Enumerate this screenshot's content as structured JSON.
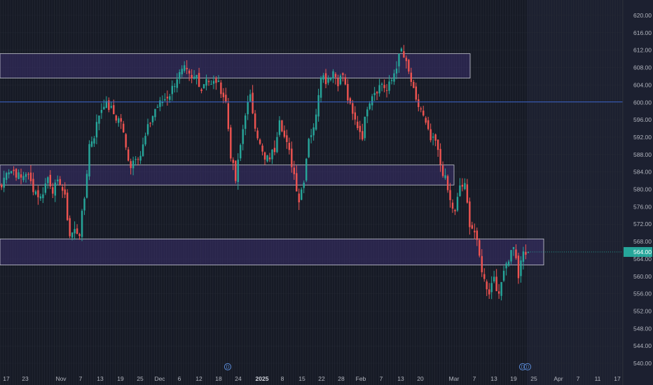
{
  "chart_data": {
    "type": "candlestick",
    "title": "",
    "ylim": [
      538,
      622
    ],
    "y_ticks": [
      "540.00",
      "544.00",
      "548.00",
      "552.00",
      "556.00",
      "560.00",
      "564.00",
      "568.00",
      "572.00",
      "576.00",
      "580.00",
      "584.00",
      "588.00",
      "592.00",
      "596.00",
      "600.00",
      "604.00",
      "608.00",
      "612.00",
      "616.00",
      "620.00"
    ],
    "x_ticks": [
      {
        "label": "17",
        "bold": false
      },
      {
        "label": "23",
        "bold": false
      },
      {
        "label": "Nov",
        "bold": false
      },
      {
        "label": "7",
        "bold": false
      },
      {
        "label": "13",
        "bold": false
      },
      {
        "label": "19",
        "bold": false
      },
      {
        "label": "25",
        "bold": false
      },
      {
        "label": "Dec",
        "bold": false
      },
      {
        "label": "6",
        "bold": false
      },
      {
        "label": "12",
        "bold": false
      },
      {
        "label": "18",
        "bold": false
      },
      {
        "label": "24",
        "bold": false
      },
      {
        "label": "2025",
        "bold": true
      },
      {
        "label": "8",
        "bold": false
      },
      {
        "label": "15",
        "bold": false
      },
      {
        "label": "22",
        "bold": false
      },
      {
        "label": "28",
        "bold": false
      },
      {
        "label": "Feb",
        "bold": false
      },
      {
        "label": "7",
        "bold": false
      },
      {
        "label": "13",
        "bold": false
      },
      {
        "label": "20",
        "bold": false
      },
      {
        "label": "Mar",
        "bold": false
      },
      {
        "label": "7",
        "bold": false
      },
      {
        "label": "13",
        "bold": false
      },
      {
        "label": "19",
        "bold": false
      },
      {
        "label": "25",
        "bold": false
      },
      {
        "label": "Apr",
        "bold": false
      },
      {
        "label": "7",
        "bold": false
      },
      {
        "label": "11",
        "bold": false
      },
      {
        "label": "17",
        "bold": false
      }
    ],
    "zones": [
      {
        "y_top": 611.2,
        "y_bottom": 605.6,
        "extends_to": "Feb 28"
      },
      {
        "y_top": 585.6,
        "y_bottom": 581.0,
        "extends_to": "Mar 24"
      },
      {
        "y_top": 568.6,
        "y_bottom": 562.6,
        "extends_to": "Mar 30"
      }
    ],
    "horizontal_line": 600.1,
    "current_price": 565.6,
    "current_price_label": "564.00",
    "event_markers": [
      "D",
      "D",
      "D"
    ],
    "colors": {
      "up": "#26a69a",
      "down": "#ef5350",
      "zone_fill": "#3a2f6b",
      "zone_border": "#c7c9d3",
      "hline": "#3b63c9",
      "price_tag": "#26a69a",
      "background": "#161a25",
      "grid": "#2a2e39"
    },
    "waypoints": [
      [
        0,
        580.5
      ],
      [
        2,
        584.6
      ],
      [
        5,
        584.2
      ],
      [
        8,
        582.5
      ],
      [
        10,
        584.0
      ],
      [
        13,
        580.3
      ],
      [
        16,
        578.0
      ],
      [
        19,
        582.8
      ],
      [
        21,
        580.0
      ],
      [
        24,
        581.8
      ],
      [
        26,
        577.8
      ],
      [
        28,
        569.4
      ],
      [
        30,
        570.5
      ],
      [
        32,
        570.0
      ],
      [
        34,
        578.0
      ],
      [
        36,
        590.3
      ],
      [
        38,
        592.5
      ],
      [
        40,
        597.3
      ],
      [
        42,
        599.9
      ],
      [
        45,
        598.3
      ],
      [
        47,
        596.4
      ],
      [
        49,
        595.8
      ],
      [
        51,
        589.3
      ],
      [
        53,
        585.5
      ],
      [
        55,
        587.9
      ],
      [
        57,
        587.9
      ],
      [
        60,
        594.0
      ],
      [
        63,
        598.5
      ],
      [
        66,
        600.3
      ],
      [
        69,
        602.0
      ],
      [
        72,
        605.8
      ],
      [
        75,
        607.5
      ],
      [
        78,
        605.0
      ],
      [
        80,
        606.2
      ],
      [
        82,
        603.0
      ],
      [
        84,
        606.0
      ],
      [
        86,
        603.8
      ],
      [
        88,
        605.0
      ],
      [
        90,
        603.0
      ],
      [
        92,
        600.0
      ],
      [
        94,
        588.0
      ],
      [
        96,
        582.0
      ],
      [
        98,
        590.0
      ],
      [
        100,
        597.8
      ],
      [
        102,
        601.0
      ],
      [
        104,
        595.0
      ],
      [
        106,
        590.0
      ],
      [
        108,
        586.5
      ],
      [
        110,
        587.5
      ],
      [
        112,
        589.3
      ],
      [
        114,
        596.8
      ],
      [
        116,
        592.0
      ],
      [
        118,
        588.3
      ],
      [
        120,
        583.5
      ],
      [
        122,
        577.5
      ],
      [
        124,
        582.5
      ],
      [
        126,
        592.2
      ],
      [
        128,
        593.6
      ],
      [
        131,
        606.8
      ],
      [
        133,
        605.1
      ],
      [
        136,
        607.2
      ],
      [
        138,
        604.8
      ],
      [
        140,
        606.4
      ],
      [
        142,
        600.8
      ],
      [
        144,
        596.9
      ],
      [
        146,
        594.6
      ],
      [
        148,
        592.4
      ],
      [
        150,
        599.3
      ],
      [
        152,
        602.1
      ],
      [
        154,
        603.1
      ],
      [
        156,
        604.4
      ],
      [
        158,
        602.7
      ],
      [
        160,
        605.1
      ],
      [
        162,
        608.6
      ],
      [
        164,
        612.0
      ],
      [
        166,
        608.6
      ],
      [
        168,
        604.8
      ],
      [
        170,
        599.8
      ],
      [
        172,
        598.4
      ],
      [
        174,
        594.7
      ],
      [
        176,
        591.2
      ],
      [
        178,
        590.9
      ],
      [
        180,
        585.8
      ],
      [
        182,
        582.2
      ],
      [
        184,
        577.2
      ],
      [
        186,
        574.4
      ],
      [
        188,
        580.9
      ],
      [
        190,
        580.6
      ],
      [
        192,
        572.3
      ],
      [
        194,
        570.2
      ],
      [
        196,
        564.4
      ],
      [
        198,
        559.0
      ],
      [
        200,
        556.5
      ],
      [
        202,
        560.3
      ],
      [
        204,
        555.0
      ],
      [
        206,
        562.3
      ],
      [
        208,
        564.1
      ],
      [
        210,
        567.3
      ],
      [
        212,
        560.0
      ],
      [
        214,
        565.5
      ],
      [
        216,
        564.9
      ]
    ]
  }
}
